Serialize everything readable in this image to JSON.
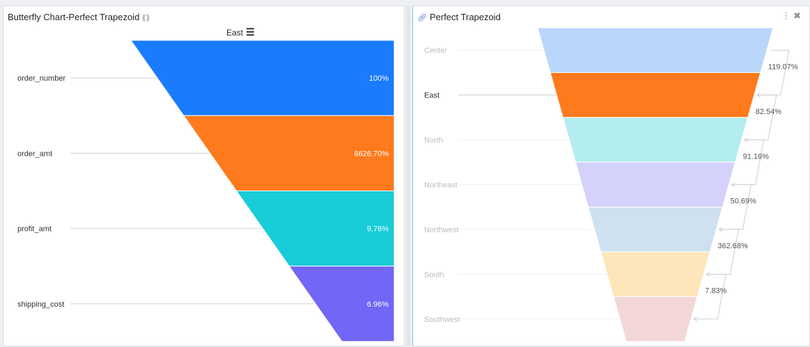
{
  "left_panel": {
    "title": "Butterfly Chart-Perfect Trapezoid",
    "title_icon": "double-chevron-icon",
    "legend_label": "East",
    "legend_icon": "menu-icon"
  },
  "right_panel": {
    "title": "Perfect Trapezoid",
    "title_icon": "link-icon",
    "tools": [
      "more-options-icon",
      "unpin-icon"
    ]
  },
  "chart_data": [
    {
      "type": "funnel",
      "series_name": "East",
      "categories": [
        "order_number",
        "order_amt",
        "profit_amt",
        "shipping_cost"
      ],
      "labels": [
        "100%",
        "6626.70%",
        "9.76%",
        "6.96%"
      ],
      "colors": [
        "#1a7bfd",
        "#fe7a1c",
        "#18ccd8",
        "#7166f5"
      ],
      "label_color": "#ffffff"
    },
    {
      "type": "funnel",
      "categories": [
        "Center",
        "East",
        "North",
        "Northeast",
        "Northwest",
        "South",
        "Southwest"
      ],
      "highlighted": "East",
      "colors": [
        "#b9d6fb",
        "#fe7a1c",
        "#b4edf0",
        "#d4d1fb",
        "#cfe1f0",
        "#fde6b9",
        "#f3d7d8"
      ],
      "conversion_rates": [
        "119.07%",
        "82.54%",
        "91.16%",
        "50.69%",
        "362.68%",
        "7.83%"
      ]
    }
  ]
}
